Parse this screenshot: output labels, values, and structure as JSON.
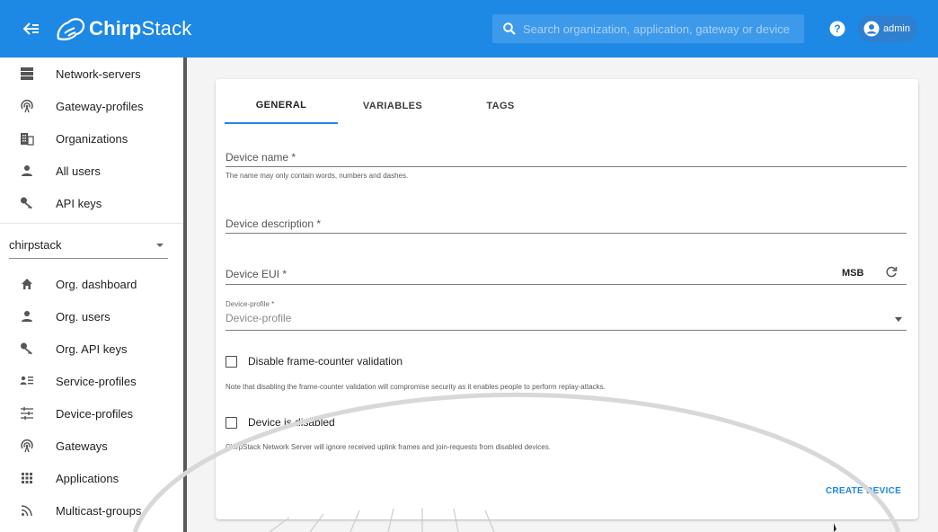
{
  "header": {
    "app_name_bold": "Chirp",
    "app_name_regular": "Stack",
    "search_placeholder": "Search organization, application, gateway or device",
    "user_label": "admin",
    "colors": {
      "primary": "#1e88e5",
      "search_bg": "#3d99ea"
    }
  },
  "sidebar": {
    "admin_items": [
      {
        "label": "Network-servers",
        "icon": "server-icon"
      },
      {
        "label": "Gateway-profiles",
        "icon": "gateway-icon"
      },
      {
        "label": "Organizations",
        "icon": "building-icon"
      },
      {
        "label": "All users",
        "icon": "user-icon"
      },
      {
        "label": "API keys",
        "icon": "key-icon"
      }
    ],
    "organization": "chirpstack",
    "org_items": [
      {
        "label": "Org. dashboard",
        "icon": "home-icon"
      },
      {
        "label": "Org. users",
        "icon": "user-icon"
      },
      {
        "label": "Org. API keys",
        "icon": "key-icon"
      },
      {
        "label": "Service-profiles",
        "icon": "service-profile-icon"
      },
      {
        "label": "Device-profiles",
        "icon": "device-profile-icon"
      },
      {
        "label": "Gateways",
        "icon": "gateway-icon"
      },
      {
        "label": "Applications",
        "icon": "apps-grid-icon"
      },
      {
        "label": "Multicast-groups",
        "icon": "rss-icon"
      }
    ]
  },
  "form": {
    "tabs": [
      {
        "label": "GENERAL",
        "active": true
      },
      {
        "label": "VARIABLES",
        "active": false
      },
      {
        "label": "TAGS",
        "active": false
      }
    ],
    "device_name": {
      "label": "Device name *",
      "help": "The name may only contain words, numbers and dashes."
    },
    "device_description": {
      "label": "Device description *"
    },
    "device_eui": {
      "label": "Device EUI *",
      "byte_order": "MSB"
    },
    "device_profile": {
      "small_label": "Device-profile *",
      "placeholder": "Device-profile"
    },
    "skip_fcnt_check": {
      "label": "Disable frame-counter validation",
      "help": "Note that disabling the frame-counter validation will compromise security as it enables people to perform replay-attacks.",
      "checked": false
    },
    "is_disabled": {
      "label": "Device is disabled",
      "help": "ChirpStack Network Server will ignore received uplink frames and join-requests from disabled devices.",
      "checked": false
    },
    "submit_label": "CREATE DEVICE"
  }
}
